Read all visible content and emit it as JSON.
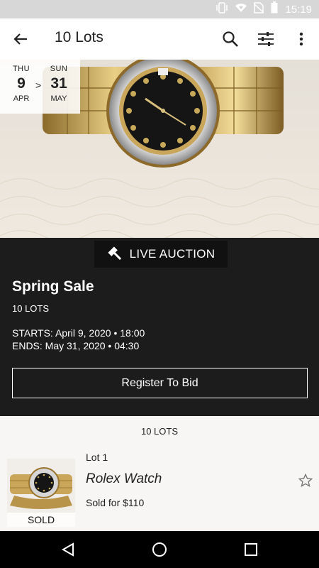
{
  "status_bar": {
    "time": "15:19",
    "icons": [
      "vibrate-icon",
      "wifi-icon",
      "no-sim-icon",
      "battery-icon"
    ]
  },
  "app_bar": {
    "title": "10 Lots",
    "icons": [
      "back-arrow-icon",
      "search-icon",
      "filter-icon",
      "more-vert-icon"
    ]
  },
  "dates": {
    "start": {
      "dow": "THU",
      "day": "9",
      "month": "APR"
    },
    "separator": ">",
    "end": {
      "dow": "SUN",
      "day": "31",
      "month": "MAY"
    }
  },
  "auction": {
    "badge": "LIVE AUCTION",
    "badge_icon": "gavel-icon",
    "title": "Spring Sale",
    "lot_count": "10 LOTS",
    "starts": "STARTS: April 9, 2020 • 18:00",
    "ends": "ENDS: May 31, 2020 • 04:30",
    "register_label": "Register To Bid"
  },
  "lots": {
    "header": "10 LOTS",
    "items": [
      {
        "number": "Lot 1",
        "name": "Rolex Watch",
        "price": "Sold for $110",
        "status": "SOLD",
        "favorite_icon": "star-outline-icon"
      }
    ]
  },
  "nav": {
    "icons": [
      "back-triangle-icon",
      "home-circle-icon",
      "recents-square-icon"
    ]
  },
  "colors": {
    "dark_bg": "#1c1c1c",
    "status_bar": "#d7d7d7",
    "list_bg": "#f7f6f4"
  }
}
